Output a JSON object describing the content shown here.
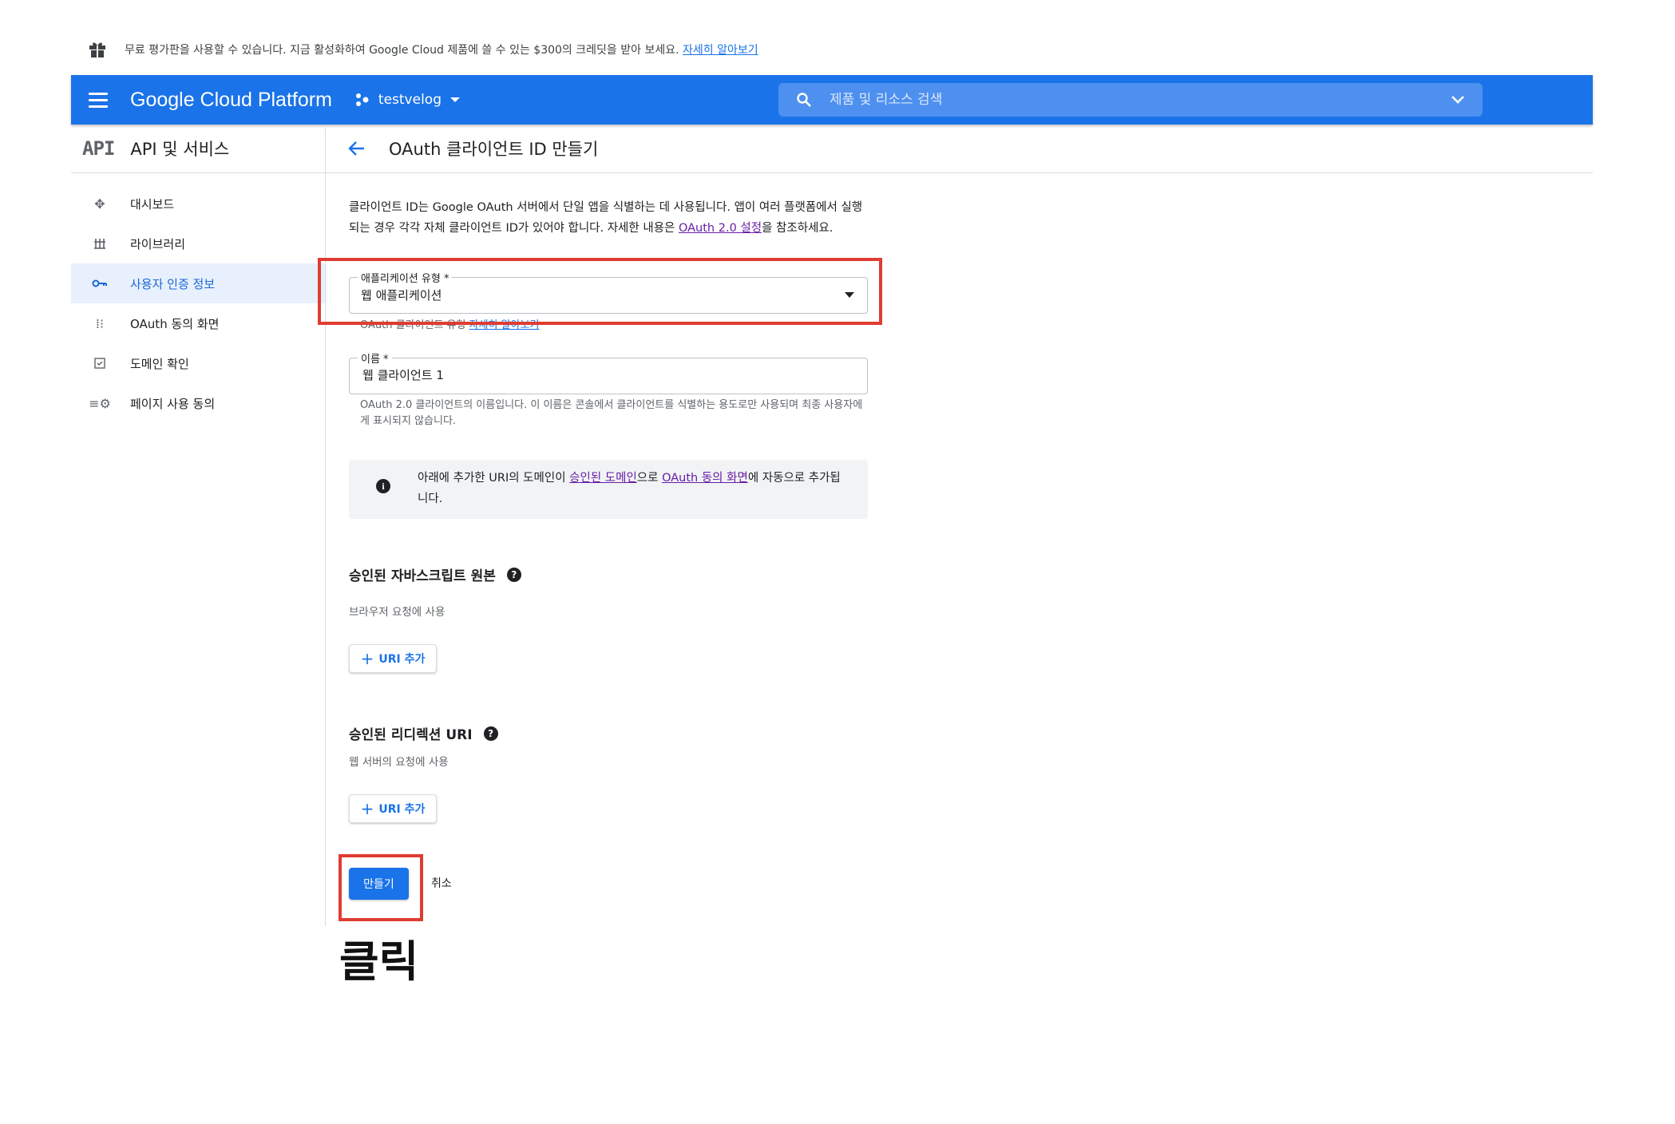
{
  "promo": {
    "text": "무료 평가판을 사용할 수 있습니다. 지금 활성화하여 Google Cloud 제품에 쓸 수 있는 $300의 크레딧을 받아 보세요.",
    "link": "자세히 알아보기"
  },
  "header": {
    "brand": "Google Cloud Platform",
    "project": "testvelog",
    "search_placeholder": "제품 및 리소스 검색"
  },
  "sidebar": {
    "logo": "API",
    "title": "API 및 서비스",
    "items": [
      {
        "label": "대시보드",
        "icon": "dashboard-icon"
      },
      {
        "label": "라이브러리",
        "icon": "library-icon"
      },
      {
        "label": "사용자 인증 정보",
        "icon": "key-icon",
        "active": true
      },
      {
        "label": "OAuth 동의 화면",
        "icon": "consent-icon"
      },
      {
        "label": "도메인 확인",
        "icon": "domain-check-icon"
      },
      {
        "label": "페이지 사용 동의",
        "icon": "page-agreement-icon"
      }
    ]
  },
  "main": {
    "title": "OAuth 클라이언트 ID 만들기",
    "desc_1": "클라이언트 ID는 Google OAuth 서버에서 단일 앱을 식별하는 데 사용됩니다. 앱이 여러 플랫폼에서 실행되는 경우 각각 자체 클라이언트 ID가 있어야 합니다. 자세한 내용은 ",
    "desc_link": "OAuth 2.0 설정",
    "desc_2": "을 참조하세요.",
    "app_type": {
      "label": "애플리케이션 유형 *",
      "value": "웹 애플리케이션",
      "hint_text": "OAuth 클라이언트 유형 ",
      "hint_link": "자세히 알아보기"
    },
    "name": {
      "label": "이름 *",
      "value": "웹 클라이언트 1",
      "hint": "OAuth 2.0 클라이언트의 이름입니다. 이 이름은 콘솔에서 클라이언트를 식별하는 용도로만 사용되며 최종 사용자에게 표시되지 않습니다."
    },
    "notice": {
      "t1": "아래에 추가한 URI의 도메인이 ",
      "link1": "승인된 도메인",
      "t2": "으로 ",
      "link2": "OAuth 동의 화면",
      "t3": "에 자동으로 추가됩니다."
    },
    "js_origins": {
      "title": "승인된 자바스크립트 원본",
      "sub": "브라우저 요청에 사용",
      "button": "URI 추가"
    },
    "redirect_uris": {
      "title": "승인된 리디렉션 URI",
      "sub": "웹 서버의 요청에 사용",
      "button": "URI 추가"
    },
    "create_button": "만들기",
    "cancel_button": "취소"
  },
  "annotation": {
    "caption": "클릭",
    "highlight_color": "#e03c31"
  },
  "colors": {
    "brand_blue": "#1a73e8",
    "active_bg": "#e8f0fe"
  }
}
